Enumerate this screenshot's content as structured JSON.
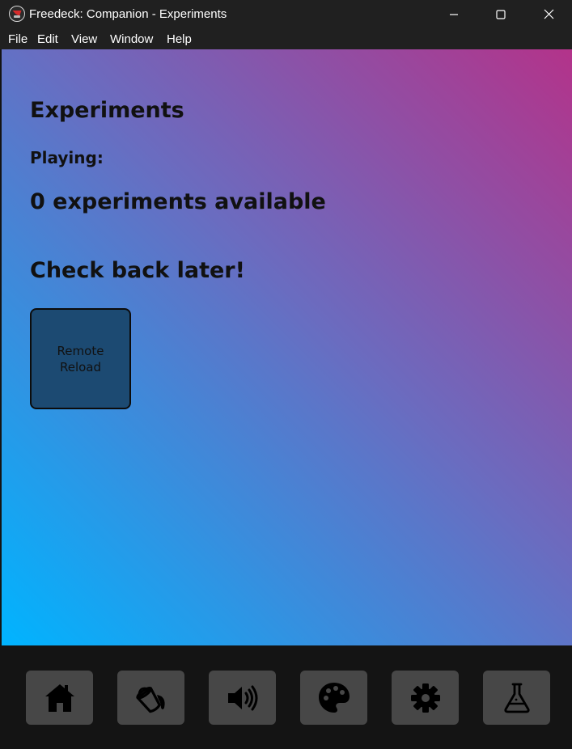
{
  "window": {
    "title": "Freedeck: Companion - Experiments",
    "controls": [
      "minimize-icon",
      "maximize-icon",
      "close-icon"
    ]
  },
  "menu": {
    "items": [
      {
        "label": "File"
      },
      {
        "label": "Edit"
      },
      {
        "label": "View"
      },
      {
        "label": "Window"
      },
      {
        "label": "Help"
      }
    ]
  },
  "main": {
    "title": "Experiments",
    "playing_label": "Playing:",
    "count_text": "0 experiments available",
    "message": "Check back later!",
    "reload_button_label": "Remote Reload"
  },
  "bottom_nav": {
    "items": [
      {
        "icon": "home-icon"
      },
      {
        "icon": "paint-bucket-icon"
      },
      {
        "icon": "volume-icon"
      },
      {
        "icon": "palette-icon"
      },
      {
        "icon": "gear-icon"
      },
      {
        "icon": "flask-icon"
      }
    ]
  },
  "colors": {
    "titlebar": "#202020",
    "gradient_start": "#00b4ff",
    "gradient_mid": "#6a6cc0",
    "gradient_end": "#b3338a",
    "button_bg": "#1c4a72",
    "nav_button_bg": "#474747",
    "bottombar": "#141414"
  }
}
